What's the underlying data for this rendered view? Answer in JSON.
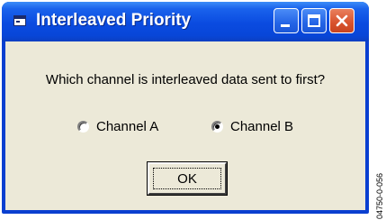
{
  "window": {
    "title": "Interleaved Priority",
    "question": "Which channel is interleaved data sent to first?",
    "options": [
      {
        "label": "Channel A",
        "selected": false
      },
      {
        "label": "Channel B",
        "selected": true
      }
    ],
    "ok_label": "OK",
    "icons": {
      "app": "window-icon",
      "minimize": "minimize-icon",
      "maximize": "maximize-icon",
      "close": "close-icon"
    },
    "colors": {
      "titlebar": "#0a4be0",
      "close_button": "#d8522c",
      "dialog_face": "#ece9d8"
    }
  },
  "figure_id": "04750-0-056"
}
